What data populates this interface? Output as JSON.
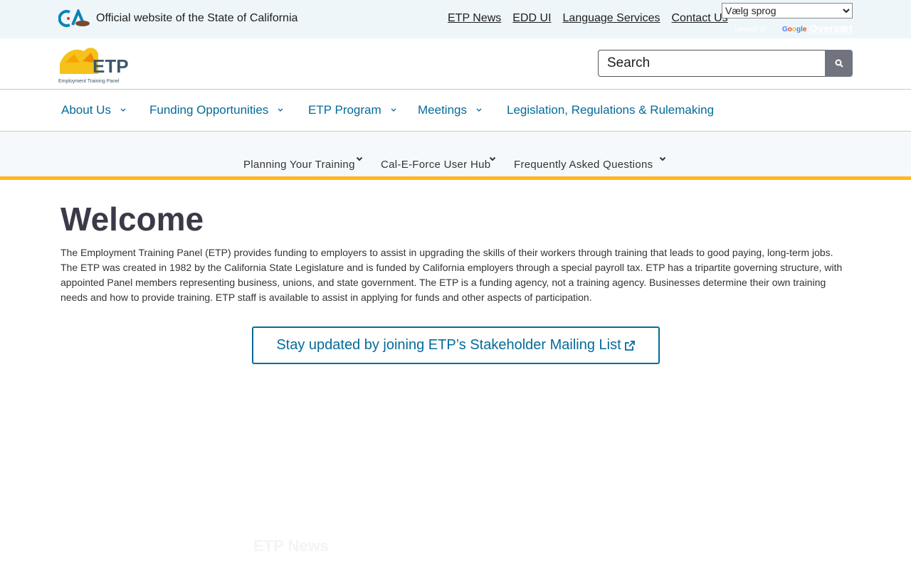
{
  "utility": {
    "official_text": "Official website of the State of California",
    "links": [
      "ETP News",
      "EDD UI",
      "Language Services",
      "Contact Us"
    ],
    "language_select": {
      "selected": "Vælg sprog"
    },
    "powered_by": "Leveret af",
    "google": "Google",
    "translate": "Oversæt"
  },
  "header": {
    "logo_text": "ETP",
    "logo_subtitle": "Employment Training Panel",
    "search": {
      "placeholder": "Search"
    }
  },
  "nav": {
    "items": [
      {
        "label": "About Us",
        "has_dropdown": true
      },
      {
        "label": "Funding Opportunities",
        "has_dropdown": true
      },
      {
        "label": "ETP Program",
        "has_dropdown": true
      },
      {
        "label": "Meetings",
        "has_dropdown": true
      },
      {
        "label": "Legislation, Regulations & Rulemaking",
        "has_dropdown": false
      }
    ]
  },
  "subnav": {
    "items": [
      {
        "label": "Planning Your Training"
      },
      {
        "label": "Cal-E-Force User Hub"
      },
      {
        "label": "Frequently Asked Questions"
      }
    ]
  },
  "main": {
    "title": "Welcome",
    "intro": "The Employment Training Panel (ETP) provides funding to employers to assist in upgrading the skills of their workers through training that leads to good paying, long-term jobs. The ETP was created in 1982 by the California State Legislature and is funded by California employers through a special payroll tax. ETP has a tripartite governing structure, with appointed Panel members representing business, unions, and state government. The ETP is a funding agency, not a training agency. Businesses determine their own training needs and how to provide training. ETP staff is available to assist in applying for funds and other aspects of participation.",
    "mailing_button": "Stay updated by joining ETP’s Stakeholder Mailing List",
    "news_heading": "ETP News"
  },
  "colors": {
    "link_blue": "#046b99",
    "gold": "#fdb81e",
    "utility_bg": "#eef6fa",
    "title": "#3b3a48"
  }
}
